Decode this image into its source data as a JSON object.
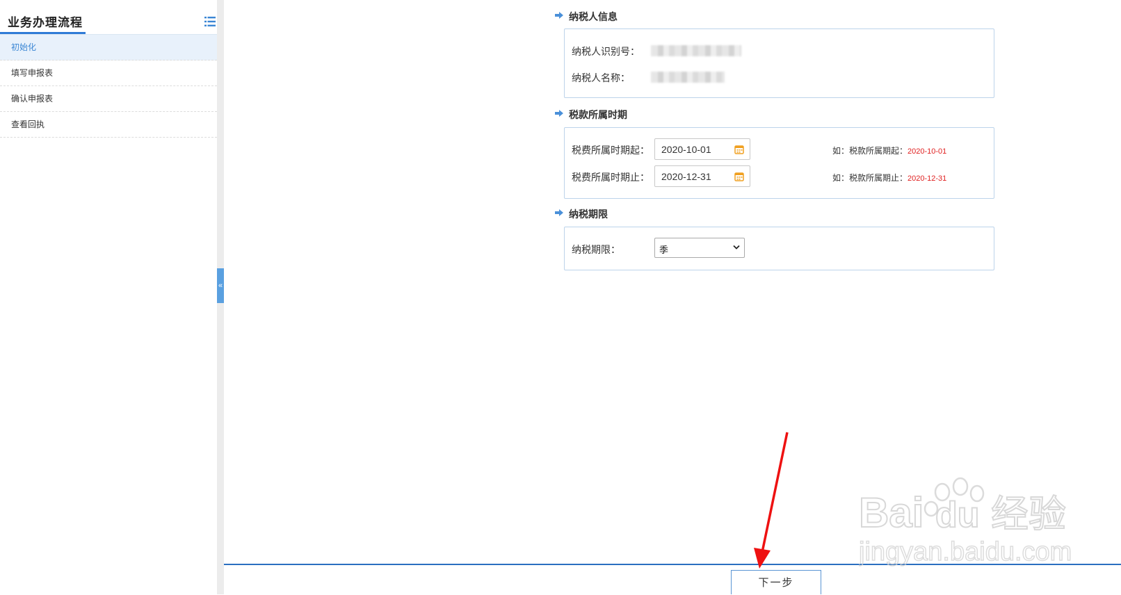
{
  "sidebar": {
    "title": "业务办理流程",
    "items": [
      {
        "label": "初始化"
      },
      {
        "label": "填写申报表"
      },
      {
        "label": "确认申报表"
      },
      {
        "label": "查看回执"
      }
    ]
  },
  "splitter": {
    "collapse_glyph": "«"
  },
  "sections": {
    "taxpayer": {
      "title": "纳税人信息",
      "id_label": "纳税人识别号：",
      "name_label": "纳税人名称："
    },
    "period": {
      "title": "税款所属时期",
      "start_label": "税费所属时期起：",
      "start_value": "2020-10-01",
      "end_label": "税费所属时期止：",
      "end_value": "2020-12-31",
      "start_hint_prefix": "如：税款所属期起：",
      "start_hint_value": "2020-10-01",
      "end_hint_prefix": "如：税款所属期止：",
      "end_hint_value": "2020-12-31"
    },
    "deadline": {
      "title": "纳税期限",
      "label": "纳税期限：",
      "selected": "季"
    }
  },
  "footer": {
    "next_label": "下一步"
  },
  "watermark": {
    "brand": "Bai",
    "brand2": "du",
    "cn": "经验",
    "url": "jingyan.baidu.com"
  },
  "colors": {
    "accent": "#2f7bd6",
    "hint_red": "#e02020",
    "arrow_red": "#ee1111"
  },
  "icons": [
    "menu-list-icon",
    "section-arrow-icon",
    "calendar-icon",
    "chevron-down-icon",
    "collapse-left-icon"
  ]
}
